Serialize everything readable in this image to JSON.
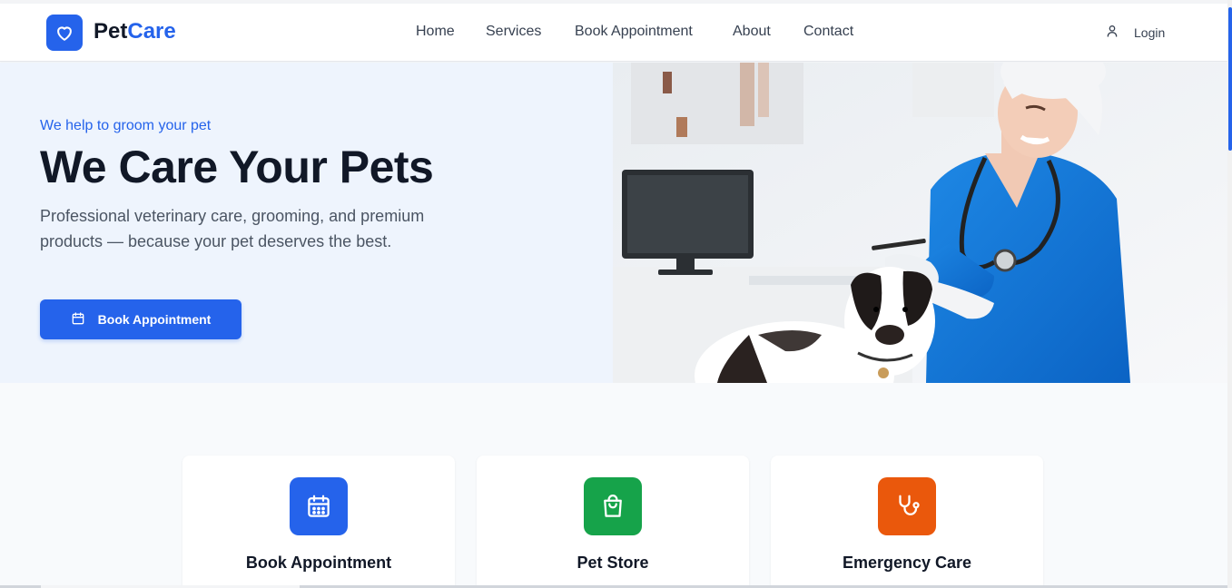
{
  "brand": {
    "name_part1": "Pet",
    "name_part2": "Care",
    "logo_icon": "heart-icon",
    "accent_color": "#2563eb"
  },
  "nav": {
    "items": [
      {
        "label": "Home"
      },
      {
        "label": "Services"
      },
      {
        "label": "Book Appointment"
      },
      {
        "label": "About"
      },
      {
        "label": "Contact"
      }
    ],
    "login_label": "Login",
    "login_icon": "user-icon"
  },
  "hero": {
    "eyebrow": "We help to groom your pet",
    "title": "We Care Your Pets",
    "description": "Professional veterinary care, grooming, and premium products — because your pet deserves the best.",
    "cta_label": "Book Appointment",
    "cta_icon": "calendar-icon",
    "image_description": "Veterinarian in blue scrubs examining a black and white dog"
  },
  "services": [
    {
      "title": "Book Appointment",
      "icon": "calendar-icon",
      "color": "#2563eb"
    },
    {
      "title": "Pet Store",
      "icon": "shopping-bag-icon",
      "color": "#16a34a"
    },
    {
      "title": "Emergency Care",
      "icon": "stethoscope-icon",
      "color": "#ea580c"
    }
  ]
}
